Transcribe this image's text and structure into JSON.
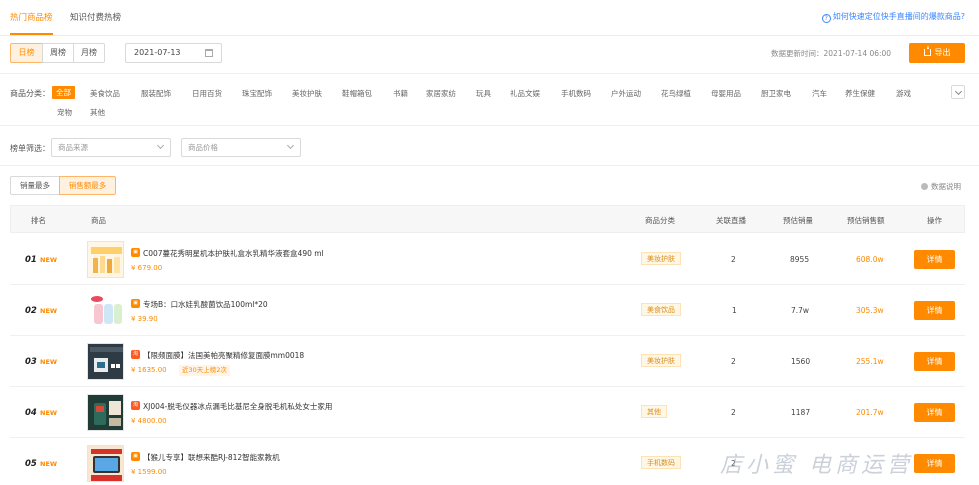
{
  "tabs": [
    {
      "label": "热门商品榜",
      "active": true
    },
    {
      "label": "知识付费热榜",
      "active": false
    }
  ],
  "help_link": "如何快速定位快手直播间的爆款商品?",
  "period_buttons": [
    {
      "label": "日榜",
      "active": true
    },
    {
      "label": "周榜",
      "active": false
    },
    {
      "label": "月榜",
      "active": false
    }
  ],
  "date_value": "2021-07-13",
  "update_time": "数据更新时间：2021-07-14 06:00",
  "export_label": "导出",
  "category_label": "商品分类：",
  "categories": [
    "全部",
    "美食饮品",
    "服装配饰",
    "日用百货",
    "珠宝配饰",
    "美妆护肤",
    "鞋帽箱包",
    "书籍",
    "家居家纺",
    "玩具",
    "礼品文娱",
    "手机数码",
    "户外运动",
    "花鸟绿植",
    "母婴用品",
    "厨卫家电",
    "汽车",
    "养生保健",
    "游戏",
    "宠物",
    "其他"
  ],
  "filter_label": "榜单筛选：",
  "filters": [
    {
      "placeholder": "商品来源"
    },
    {
      "placeholder": "商品价格"
    }
  ],
  "sort_buttons": [
    {
      "label": "销量最多",
      "active": false
    },
    {
      "label": "销售额最多",
      "active": true
    }
  ],
  "data_desc": "数据说明",
  "columns": [
    "排名",
    "商品",
    "商品分类",
    "关联直播",
    "预估销量",
    "预估销售额",
    "操作"
  ],
  "rows": [
    {
      "rank": "01",
      "new": "NEW",
      "shop": "orange",
      "name": "C007蔓花秀明星机本护肤礼盒水乳精华液套盒490 ml",
      "price": "¥ 679.00",
      "promo": "",
      "category": "美妆护肤",
      "live": "2",
      "sales": "8955",
      "revenue": "608.0w",
      "action": "详情"
    },
    {
      "rank": "02",
      "new": "NEW",
      "shop": "orange",
      "name": "专场B：口水娃乳酸菌饮品100ml*20",
      "price": "¥ 39.90",
      "promo": "",
      "category": "美食饮品",
      "live": "1",
      "sales": "7.7w",
      "revenue": "305.3w",
      "action": "详情"
    },
    {
      "rank": "03",
      "new": "NEW",
      "shop": "red",
      "name": "【限频面膜】法国美帕亮聚精修复面膜mm0018",
      "price": "¥ 1635.00",
      "promo": "近30天上榜2次",
      "category": "美妆护肤",
      "live": "2",
      "sales": "1560",
      "revenue": "255.1w",
      "action": "详情"
    },
    {
      "rank": "04",
      "new": "NEW",
      "shop": "red",
      "name": "XJ004-脱毛仪器冰点漏毛比基尼全身脱毛机私处女士家用",
      "price": "¥ 4800.00",
      "promo": "",
      "category": "其他",
      "live": "2",
      "sales": "1187",
      "revenue": "201.7w",
      "action": "详情"
    },
    {
      "rank": "05",
      "new": "NEW",
      "shop": "orange",
      "name": "【猴儿专享】联想来酷RJ-812智能家教机",
      "price": "¥ 1599.00",
      "promo": "",
      "category": "手机数码",
      "live": "2",
      "sales": "",
      "revenue": "",
      "action": "详情"
    }
  ],
  "watermark": "店小蜜 电商运营"
}
